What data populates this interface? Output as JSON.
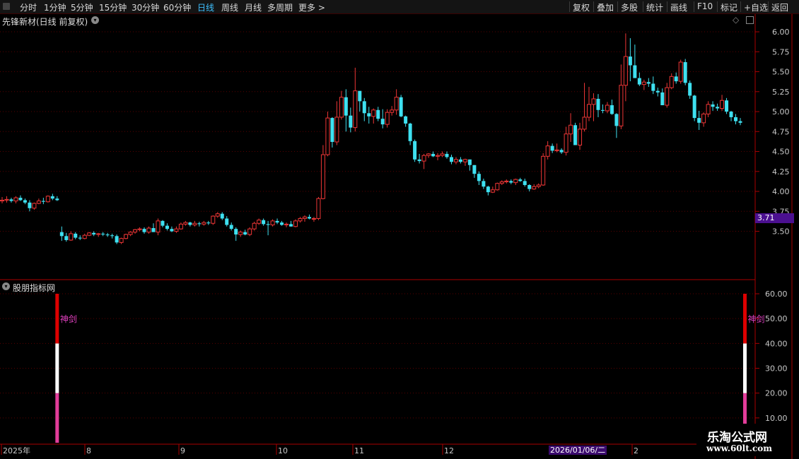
{
  "toolbar": {
    "periods": [
      "分时",
      "1分钟",
      "5分钟",
      "15分钟",
      "30分钟",
      "60分钟",
      "日线",
      "周线",
      "月线",
      "多周期",
      "更多"
    ],
    "active": "日线",
    "actions": [
      "复权",
      "叠加",
      "多股",
      "统计",
      "画线",
      "F10",
      "标记",
      "+自选",
      "返回"
    ]
  },
  "main_title": "先锋新材(日线 前复权)",
  "indicator_title": "股朋指标网",
  "price_marker": "3.71",
  "date_marker": "2026/01/06/二",
  "watermark": {
    "line1": "乐淘公式网",
    "line2": "www.60lt.com"
  },
  "colors": {
    "up": "#ee3636",
    "down": "#3ee0f0",
    "grid": "#5a0000",
    "axis": "#aa0000"
  },
  "chart_data": [
    {
      "type": "candlestick",
      "title": "先锋新材(日线 前复权)",
      "ylim": [
        3.08,
        6.08
      ],
      "y_ticks": [
        "6.00",
        "5.75",
        "5.50",
        "5.25",
        "5.00",
        "4.75",
        "4.50",
        "4.25",
        "4.00",
        "3.75",
        "3.50"
      ],
      "x_ticks": [
        "2025年",
        "8",
        "9",
        "10",
        "11",
        "12",
        "2026/01/06/二",
        "2"
      ],
      "ohlc": [
        [
          3.88,
          3.93,
          3.85,
          3.89
        ],
        [
          3.89,
          3.94,
          3.86,
          3.9
        ],
        [
          3.9,
          3.92,
          3.86,
          3.88
        ],
        [
          3.88,
          3.94,
          3.85,
          3.92
        ],
        [
          3.92,
          3.95,
          3.88,
          3.89
        ],
        [
          3.89,
          3.91,
          3.84,
          3.86
        ],
        [
          3.86,
          3.89,
          3.75,
          3.79
        ],
        [
          3.79,
          3.86,
          3.77,
          3.85
        ],
        [
          3.85,
          3.91,
          3.84,
          3.88
        ],
        [
          3.88,
          3.92,
          3.84,
          3.87
        ],
        [
          3.87,
          3.95,
          3.86,
          3.94
        ],
        [
          3.94,
          3.97,
          3.89,
          3.91
        ],
        [
          3.91,
          3.94,
          3.88,
          3.89
        ],
        [
          3.49,
          3.56,
          3.38,
          3.44
        ],
        [
          3.44,
          3.48,
          3.37,
          3.39
        ],
        [
          3.39,
          3.5,
          3.38,
          3.47
        ],
        [
          3.47,
          3.49,
          3.4,
          3.42
        ],
        [
          3.42,
          3.45,
          3.39,
          3.41
        ],
        [
          3.41,
          3.47,
          3.4,
          3.45
        ],
        [
          3.45,
          3.49,
          3.44,
          3.48
        ],
        [
          3.48,
          3.5,
          3.44,
          3.46
        ],
        [
          3.46,
          3.48,
          3.43,
          3.47
        ],
        [
          3.47,
          3.49,
          3.44,
          3.46
        ],
        [
          3.46,
          3.48,
          3.43,
          3.45
        ],
        [
          3.45,
          3.47,
          3.41,
          3.44
        ],
        [
          3.44,
          3.46,
          3.34,
          3.36
        ],
        [
          3.36,
          3.42,
          3.34,
          3.41
        ],
        [
          3.41,
          3.47,
          3.4,
          3.46
        ],
        [
          3.46,
          3.5,
          3.44,
          3.49
        ],
        [
          3.49,
          3.53,
          3.47,
          3.52
        ],
        [
          3.52,
          3.55,
          3.5,
          3.53
        ],
        [
          3.53,
          3.55,
          3.47,
          3.49
        ],
        [
          3.49,
          3.56,
          3.47,
          3.54
        ],
        [
          3.54,
          3.6,
          3.53,
          3.49
        ],
        [
          3.49,
          3.66,
          3.45,
          3.63
        ],
        [
          3.63,
          3.64,
          3.55,
          3.57
        ],
        [
          3.57,
          3.6,
          3.51,
          3.53
        ],
        [
          3.53,
          3.56,
          3.49,
          3.5
        ],
        [
          3.5,
          3.56,
          3.48,
          3.53
        ],
        [
          3.53,
          3.61,
          3.52,
          3.59
        ],
        [
          3.59,
          3.63,
          3.57,
          3.61
        ],
        [
          3.61,
          3.62,
          3.56,
          3.58
        ],
        [
          3.58,
          3.63,
          3.56,
          3.6
        ],
        [
          3.6,
          3.62,
          3.56,
          3.59
        ],
        [
          3.59,
          3.63,
          3.57,
          3.61
        ],
        [
          3.61,
          3.63,
          3.58,
          3.6
        ],
        [
          3.6,
          3.7,
          3.58,
          3.69
        ],
        [
          3.69,
          3.74,
          3.67,
          3.72
        ],
        [
          3.72,
          3.74,
          3.64,
          3.66
        ],
        [
          3.66,
          3.69,
          3.56,
          3.58
        ],
        [
          3.58,
          3.61,
          3.51,
          3.53
        ],
        [
          3.53,
          3.55,
          3.38,
          3.46
        ],
        [
          3.46,
          3.51,
          3.43,
          3.49
        ],
        [
          3.49,
          3.52,
          3.45,
          3.46
        ],
        [
          3.46,
          3.55,
          3.44,
          3.53
        ],
        [
          3.53,
          3.62,
          3.51,
          3.6
        ],
        [
          3.6,
          3.66,
          3.58,
          3.64
        ],
        [
          3.64,
          3.66,
          3.57,
          3.59
        ],
        [
          3.59,
          3.63,
          3.45,
          3.58
        ],
        [
          3.58,
          3.65,
          3.56,
          3.63
        ],
        [
          3.63,
          3.66,
          3.59,
          3.61
        ],
        [
          3.61,
          3.63,
          3.57,
          3.58
        ],
        [
          3.58,
          3.61,
          3.55,
          3.59
        ],
        [
          3.59,
          3.63,
          3.56,
          3.56
        ],
        [
          3.56,
          3.65,
          3.55,
          3.63
        ],
        [
          3.63,
          3.68,
          3.61,
          3.66
        ],
        [
          3.66,
          3.7,
          3.62,
          3.68
        ],
        [
          3.68,
          3.71,
          3.65,
          3.66
        ],
        [
          3.66,
          3.68,
          3.62,
          3.66
        ],
        [
          3.66,
          3.93,
          3.64,
          3.91
        ],
        [
          3.91,
          4.58,
          3.9,
          4.46
        ],
        [
          4.46,
          5.0,
          4.44,
          4.92
        ],
        [
          4.92,
          4.93,
          4.55,
          4.62
        ],
        [
          4.62,
          5.13,
          4.58,
          4.93
        ],
        [
          4.93,
          5.26,
          4.9,
          5.18
        ],
        [
          5.18,
          5.28,
          4.75,
          4.95
        ],
        [
          4.95,
          5.05,
          4.74,
          4.8
        ],
        [
          4.8,
          5.55,
          4.75,
          5.26
        ],
        [
          5.26,
          5.24,
          5.0,
          5.13
        ],
        [
          5.13,
          5.17,
          4.88,
          4.98
        ],
        [
          4.98,
          5.06,
          4.85,
          4.94
        ],
        [
          4.94,
          5.04,
          4.85,
          5.02
        ],
        [
          5.02,
          5.06,
          4.88,
          4.91
        ],
        [
          4.91,
          5.03,
          4.79,
          4.84
        ],
        [
          4.84,
          5.03,
          4.8,
          4.99
        ],
        [
          4.99,
          5.07,
          4.95,
          5.02
        ],
        [
          5.02,
          5.28,
          4.96,
          5.18
        ],
        [
          5.18,
          5.21,
          4.93,
          4.94
        ],
        [
          4.94,
          4.95,
          4.81,
          4.85
        ],
        [
          4.85,
          4.86,
          4.58,
          4.63
        ],
        [
          4.63,
          4.65,
          4.37,
          4.4
        ],
        [
          4.4,
          4.47,
          4.35,
          4.38
        ],
        [
          4.38,
          4.47,
          4.28,
          4.45
        ],
        [
          4.45,
          4.48,
          4.42,
          4.47
        ],
        [
          4.47,
          4.5,
          4.43,
          4.44
        ],
        [
          4.44,
          4.48,
          4.39,
          4.45
        ],
        [
          4.45,
          4.5,
          4.43,
          4.47
        ],
        [
          4.47,
          4.5,
          4.41,
          4.43
        ],
        [
          4.43,
          4.46,
          4.34,
          4.37
        ],
        [
          4.37,
          4.43,
          4.34,
          4.4
        ],
        [
          4.4,
          4.43,
          4.35,
          4.37
        ],
        [
          4.37,
          4.41,
          4.32,
          4.4
        ],
        [
          4.4,
          4.4,
          4.26,
          4.33
        ],
        [
          4.33,
          4.33,
          4.17,
          4.22
        ],
        [
          4.22,
          4.25,
          4.08,
          4.13
        ],
        [
          4.13,
          4.16,
          4.03,
          4.06
        ],
        [
          4.06,
          4.07,
          3.95,
          3.99
        ],
        [
          3.99,
          4.06,
          3.98,
          4.02
        ],
        [
          4.02,
          4.11,
          4.01,
          4.1
        ],
        [
          4.1,
          4.14,
          4.08,
          4.12
        ],
        [
          4.12,
          4.15,
          4.1,
          4.13
        ],
        [
          4.13,
          4.15,
          4.09,
          4.11
        ],
        [
          4.11,
          4.16,
          4.08,
          4.15
        ],
        [
          4.15,
          4.17,
          4.12,
          4.13
        ],
        [
          4.13,
          4.16,
          4.06,
          4.08
        ],
        [
          4.08,
          4.09,
          4.0,
          4.03
        ],
        [
          4.03,
          4.09,
          4.02,
          4.06
        ],
        [
          4.06,
          4.1,
          4.04,
          4.08
        ],
        [
          4.08,
          4.48,
          4.07,
          4.44
        ],
        [
          4.44,
          4.63,
          4.4,
          4.57
        ],
        [
          4.57,
          4.6,
          4.48,
          4.51
        ],
        [
          4.51,
          4.6,
          4.49,
          4.52
        ],
        [
          4.52,
          4.54,
          4.47,
          4.49
        ],
        [
          4.49,
          4.81,
          4.45,
          4.72
        ],
        [
          4.72,
          4.98,
          4.62,
          4.83
        ],
        [
          4.83,
          4.86,
          4.59,
          4.58
        ],
        [
          4.58,
          4.86,
          4.52,
          4.78
        ],
        [
          4.78,
          5.36,
          4.75,
          4.93
        ],
        [
          4.93,
          5.31,
          4.88,
          5.09
        ],
        [
          5.09,
          5.23,
          4.88,
          5.16
        ],
        [
          5.16,
          5.22,
          4.93,
          5.02
        ],
        [
          5.02,
          5.09,
          4.98,
          5.01
        ],
        [
          5.01,
          5.12,
          4.98,
          5.08
        ],
        [
          5.08,
          5.15,
          4.96,
          4.97
        ],
        [
          4.97,
          4.98,
          4.67,
          4.82
        ],
        [
          4.82,
          5.59,
          4.78,
          5.33
        ],
        [
          5.33,
          5.98,
          5.13,
          5.69
        ],
        [
          5.69,
          5.92,
          5.38,
          5.58
        ],
        [
          5.58,
          5.84,
          5.5,
          5.42
        ],
        [
          5.42,
          5.49,
          5.32,
          5.34
        ],
        [
          5.34,
          5.4,
          5.27,
          5.37
        ],
        [
          5.37,
          5.42,
          5.31,
          5.35
        ],
        [
          5.35,
          5.44,
          5.22,
          5.26
        ],
        [
          5.26,
          5.3,
          5.19,
          5.24
        ],
        [
          5.24,
          5.29,
          5.08,
          5.08
        ],
        [
          5.08,
          5.36,
          5.05,
          5.3
        ],
        [
          5.3,
          5.48,
          5.28,
          5.44
        ],
        [
          5.44,
          5.49,
          5.35,
          5.38
        ],
        [
          5.38,
          5.65,
          5.35,
          5.62
        ],
        [
          5.62,
          5.66,
          5.33,
          5.36
        ],
        [
          5.36,
          5.39,
          5.16,
          5.2
        ],
        [
          5.2,
          5.21,
          4.88,
          4.92
        ],
        [
          4.92,
          5.01,
          4.77,
          4.86
        ],
        [
          4.86,
          4.99,
          4.81,
          4.97
        ],
        [
          4.97,
          5.13,
          4.93,
          5.09
        ],
        [
          5.09,
          5.13,
          5.01,
          5.06
        ],
        [
          5.06,
          5.1,
          5.01,
          5.04
        ],
        [
          5.04,
          5.21,
          5.01,
          5.14
        ],
        [
          5.14,
          5.17,
          4.97,
          5.0
        ],
        [
          5.0,
          5.01,
          4.88,
          4.93
        ],
        [
          4.93,
          4.97,
          4.84,
          4.88
        ],
        [
          4.88,
          4.92,
          4.83,
          4.86
        ]
      ]
    },
    {
      "type": "bar",
      "title": "股朋指标网",
      "ylim": [
        0,
        60
      ],
      "y_ticks": [
        "60.00",
        "50.00",
        "40.00",
        "30.00",
        "20.00",
        "10.00"
      ],
      "series": [
        {
          "name": "神剑",
          "bars": [
            {
              "index": 12,
              "value": 60
            },
            {
              "index": 162,
              "value": 60
            }
          ]
        }
      ],
      "segments": [
        {
          "from": 0,
          "to": 20,
          "color": "#e33d9a"
        },
        {
          "from": 20,
          "to": 40,
          "color": "#ffffff"
        },
        {
          "from": 40,
          "to": 60,
          "color": "#dd0000"
        }
      ]
    }
  ]
}
